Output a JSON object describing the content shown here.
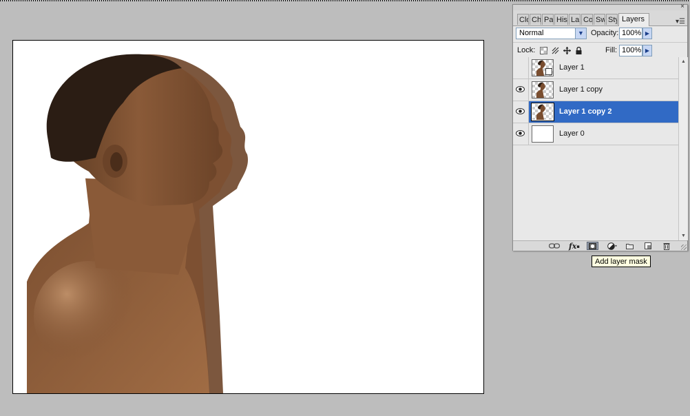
{
  "panel": {
    "tabs": [
      "Clo",
      "Ch",
      "Pa",
      "His",
      "La",
      "Co",
      "Sw",
      "Sty",
      "Layers"
    ],
    "active_tab": "Layers",
    "close_glyph": "×",
    "menu_glyph": "▾☰",
    "blend_mode": "Normal",
    "opacity_label": "Opacity:",
    "opacity_value": "100%",
    "lock_label": "Lock:",
    "fill_label": "Fill:",
    "fill_value": "100%",
    "layers": [
      {
        "name": "Layer 1",
        "visible": false,
        "selected": false,
        "thumb": "portrait-smart"
      },
      {
        "name": "Layer 1 copy",
        "visible": true,
        "selected": false,
        "thumb": "portrait"
      },
      {
        "name": "Layer 1 copy 2",
        "visible": true,
        "selected": true,
        "thumb": "portrait"
      },
      {
        "name": "Layer 0",
        "visible": true,
        "selected": false,
        "thumb": "white"
      }
    ],
    "bottom_icons": [
      "link-layers-icon",
      "fx-icon",
      "add-layer-mask-icon",
      "adjustment-layer-icon",
      "new-group-icon",
      "new-layer-icon",
      "trash-icon"
    ],
    "fx_label": "fx"
  },
  "tooltip": {
    "text": "Add layer mask"
  },
  "colors": {
    "selection": "#316ac5",
    "tooltip_bg": "#ffffe1",
    "workspace": "#bdbdbd"
  }
}
